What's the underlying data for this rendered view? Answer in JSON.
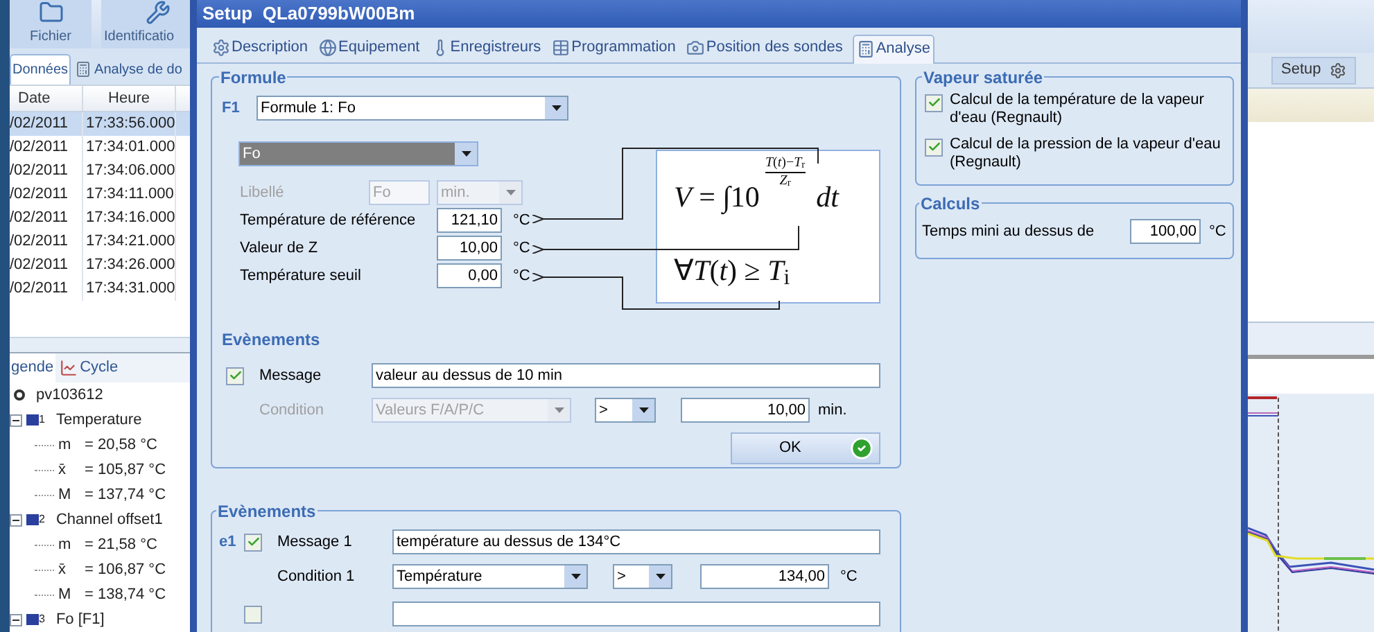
{
  "app": {
    "toolbar": [
      {
        "label": "Fichier",
        "kind": "folder"
      },
      {
        "label": "Identificatio",
        "kind": "tool"
      }
    ],
    "tabs": [
      {
        "label": "Données",
        "selected": true
      },
      {
        "label": "Analyse de do",
        "selected": false
      }
    ],
    "table": {
      "columns": [
        "Date",
        "Heure"
      ],
      "rows": [
        {
          "cells": [
            "/02/2011",
            "17:33:56.000"
          ],
          "selected": true
        },
        {
          "cells": [
            "/02/2011",
            "17:34:01.000"
          ],
          "selected": false
        },
        {
          "cells": [
            "/02/2011",
            "17:34:06.000"
          ],
          "selected": false
        },
        {
          "cells": [
            "/02/2011",
            "17:34:11.000"
          ],
          "selected": false
        },
        {
          "cells": [
            "/02/2011",
            "17:34:16.000"
          ],
          "selected": false
        },
        {
          "cells": [
            "/02/2011",
            "17:34:21.000"
          ],
          "selected": false
        },
        {
          "cells": [
            "/02/2011",
            "17:34:26.000"
          ],
          "selected": false
        },
        {
          "cells": [
            "/02/2011",
            "17:34:31.000"
          ],
          "selected": false
        }
      ]
    },
    "legend_tabs": [
      {
        "label": "gende",
        "selected": true
      },
      {
        "label": "Cycle",
        "selected": false
      }
    ],
    "legend": {
      "label": "pv103612",
      "children": [
        {
          "index": "1",
          "label": "Temperature",
          "expanded": true,
          "children": [
            {
              "symbol": "m",
              "value": "= 20,58 °C"
            },
            {
              "symbol": "x̄",
              "value": "= 105,87 °C"
            },
            {
              "symbol": "M",
              "value": "= 137,74 °C"
            }
          ]
        },
        {
          "index": "2",
          "label": "Channel offset1",
          "expanded": true,
          "children": [
            {
              "symbol": "m",
              "value": "= 21,58 °C"
            },
            {
              "symbol": "x̄",
              "value": "= 106,87 °C"
            },
            {
              "symbol": "M",
              "value": "= 138,74 °C"
            }
          ]
        },
        {
          "index": "3",
          "label": "Fo [F1]",
          "expanded": true
        }
      ]
    },
    "setup_button": "Setup"
  },
  "dialog": {
    "title": "Setup  QLa0799bW00Bm",
    "tabs": [
      {
        "label": "Description",
        "kind": "gear",
        "selected": false
      },
      {
        "label": "Equipement",
        "kind": "globe",
        "selected": false
      },
      {
        "label": "Enregistreurs",
        "kind": "probe",
        "selected": false
      },
      {
        "label": "Programmation",
        "kind": "table",
        "selected": false
      },
      {
        "label": "Position des sondes",
        "kind": "camera",
        "selected": false
      },
      {
        "label": "Analyse",
        "kind": "calculator",
        "selected": true
      }
    ],
    "formule": {
      "title": "Formule",
      "formula_label": "F1",
      "formula_select": "Formule 1: Fo",
      "type_select": "Fo",
      "libelle": {
        "label": "Libellé",
        "value": "Fo",
        "unit_select": "min.",
        "disabled": true
      },
      "params": [
        {
          "label": "Température de référence",
          "value": "121,10",
          "unit": "°C"
        },
        {
          "label": "Valeur de Z",
          "value": "10,00",
          "unit": "°C"
        },
        {
          "label": "Température seuil",
          "value": "0,00",
          "unit": "°C"
        }
      ],
      "formula": {
        "lhs": "*V* = ∫10",
        "numerator": "*T*(*t*)−*T*$_{r}$",
        "denominator": "*Z*$_{r}$",
        "differential": "dt",
        "condition": "∀*T*(*t*) ≥ *T*$_{i}$"
      },
      "events": {
        "title": "Evènements",
        "message": {
          "label": "Message",
          "checked": true,
          "value": "valeur au dessus de 10 min"
        },
        "condition": {
          "label": "Condition",
          "disabled": true,
          "select": "Valeurs F/A/P/C",
          "operator": ">",
          "value": "10,00",
          "unit": "min."
        },
        "ok_button": "OK"
      }
    },
    "vapeur": {
      "title": "Vapeur saturée",
      "options": [
        {
          "label": "Calcul de la température de la vapeur d'eau (Regnault)",
          "checked": true
        },
        {
          "label": "Calcul de la pression de la vapeur d'eau (Regnault)",
          "checked": true
        }
      ]
    },
    "calculs": {
      "title": "Calculs",
      "label": "Temps mini au dessus de",
      "value": "100,00",
      "unit": "°C"
    },
    "events": {
      "title": "Evènements",
      "items": [
        {
          "index": "e1",
          "checked": true,
          "message_label": "Message 1",
          "message": "température au dessus de 134°C",
          "condition_label": "Condition 1",
          "condition": "Température",
          "operator": ">",
          "value": "134,00",
          "unit": "°C"
        },
        {
          "checked": false
        }
      ]
    }
  }
}
